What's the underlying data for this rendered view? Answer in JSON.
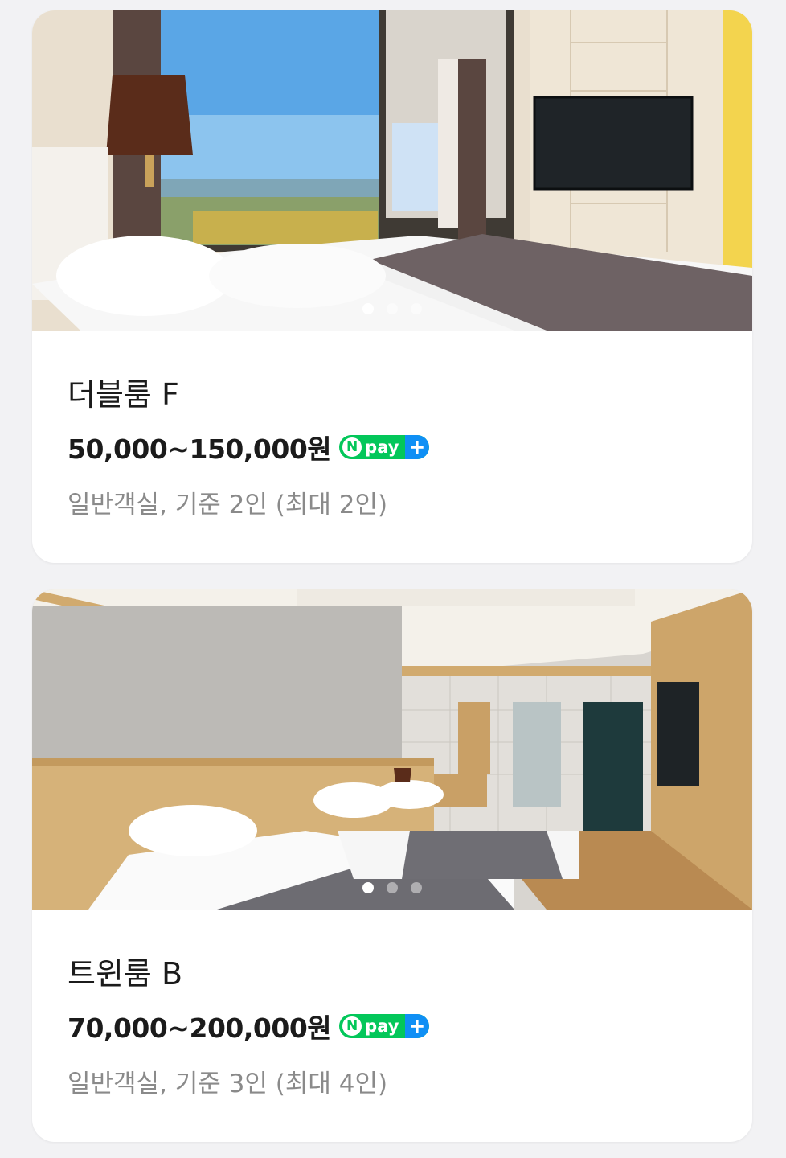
{
  "rooms": [
    {
      "name": "더블룸 F",
      "price": "50,000~150,000원",
      "badge": {
        "n": "N",
        "pay": "pay",
        "plus": "+"
      },
      "description": "일반객실, 기준 2인 (최대 2인)",
      "photo": {
        "image_count": 3,
        "active_index": 0
      }
    },
    {
      "name": "트윈룸 B",
      "price": "70,000~200,000원",
      "badge": {
        "n": "N",
        "pay": "pay",
        "plus": "+"
      },
      "description": "일반객실, 기준 3인 (최대 4인)",
      "photo": {
        "image_count": 3,
        "active_index": 0
      }
    }
  ],
  "colors": {
    "npay_green": "#03c75a",
    "npay_blue": "#0f8ff5",
    "background": "#f2f2f4"
  }
}
